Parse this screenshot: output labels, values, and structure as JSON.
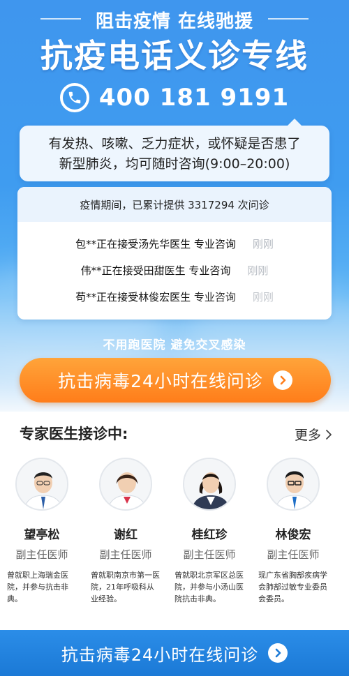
{
  "header": {
    "slogan": "阻击疫情 在线驰援",
    "title": "抗疫电话义诊专线",
    "phone": "400 181 9191"
  },
  "info": {
    "line1": "有发热、咳嗽、乏力症状，或怀疑是否患了",
    "line2": "新型肺炎，均可随时咨询(9:00–20:00)"
  },
  "stats": {
    "summary": "疫情期间，已累计提供 3317294 次问诊",
    "consultations": [
      {
        "text": "包**正在接受汤先华医生 专业咨询",
        "time": "刚刚"
      },
      {
        "text": "伟**正在接受田甜医生 专业咨询",
        "time": "刚刚"
      },
      {
        "text": "苟**正在接受林俊宏医生 专业咨询",
        "time": "刚刚"
      }
    ]
  },
  "sub_slogan": "不用跑医院 避免交叉感染",
  "cta_top": "抗击病毒24小时在线问诊",
  "experts": {
    "title": "专家医生接诊中:",
    "more": "更多",
    "doctors": [
      {
        "name": "望亭松",
        "title": "副主任医师",
        "bio": "曾就职上海瑞金医院，并参与抗击非典。",
        "shirt": "#ffffff",
        "tie": "#2d5fa8"
      },
      {
        "name": "谢红",
        "title": "副主任医师",
        "bio": "曾就职南京市第一医院，21年呼吸科从业经验。",
        "shirt": "#ffffff",
        "tie": "#d8324a"
      },
      {
        "name": "桂红珍",
        "title": "副主任医师",
        "bio": "曾就职北京军区总医院，并参与小汤山医院抗击非典。",
        "shirt": "#ffffff",
        "tie": "#2f3b55"
      },
      {
        "name": "林俊宏",
        "title": "副主任医师",
        "bio": "现广东省胸部疾病学会肺部过敏专业委员会委员。",
        "shirt": "#ffffff",
        "tie": "#1f6fc7"
      }
    ]
  },
  "cta_bottom": "抗击病毒24小时在线问诊",
  "colors": {
    "hero_blue": "#3f96ee",
    "cta_orange": "#ff8c22",
    "cta_blue": "#1f82df",
    "time_gray": "#b6bbc2"
  },
  "icons": [
    "phone-icon",
    "chevron-right-icon",
    "doctor-avatar"
  ]
}
